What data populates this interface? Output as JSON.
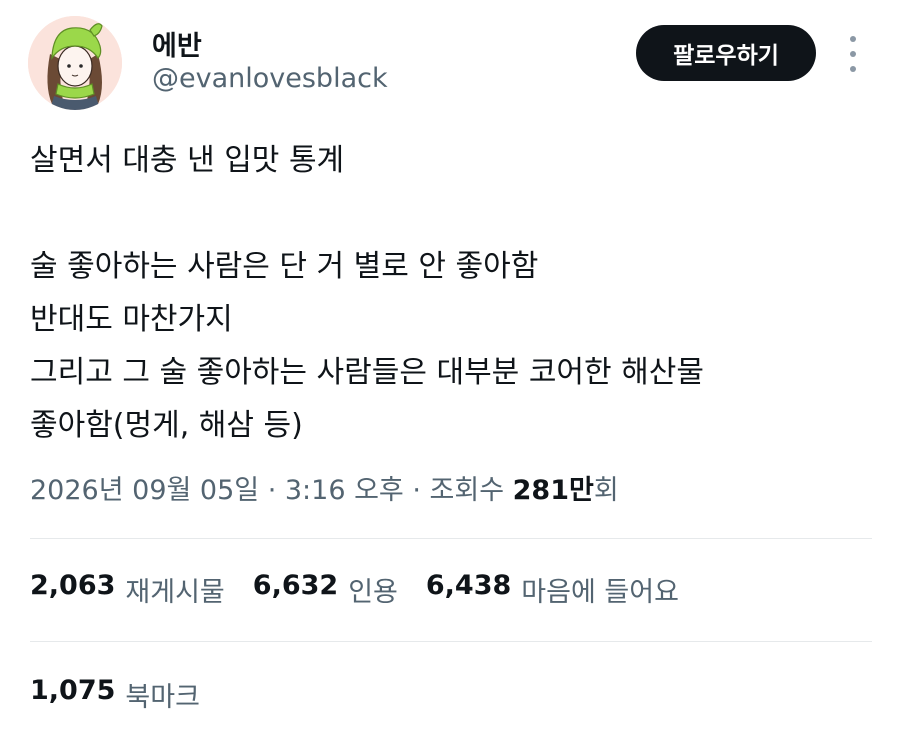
{
  "author": {
    "display_name": "에반",
    "handle": "@evanlovesblack"
  },
  "follow_button_label": "팔로우하기",
  "tweet": {
    "lines": [
      "살면서 대충 낸 입맛 통계",
      "",
      "술 좋아하는 사람은 단 거 별로 안 좋아함",
      "반대도 마찬가지",
      "그리고 그 술 좋아하는 사람들은 대부분 코어한 해산물",
      "좋아함(멍게, 해삼 등)"
    ]
  },
  "meta": {
    "date": "2026년 09월 05일",
    "separator": " · ",
    "time": "3:16 오후",
    "views_label": "조회수 ",
    "views_count": "281만",
    "views_suffix": "회"
  },
  "stats": {
    "reposts": {
      "count": "2,063",
      "label": "재게시물"
    },
    "quotes": {
      "count": "6,632",
      "label": "인용"
    },
    "likes": {
      "count": "6,438",
      "label": "마음에 들어요"
    }
  },
  "bookmarks": {
    "count": "1,075",
    "label": "북마크"
  },
  "colors": {
    "text_primary": "#0f1419",
    "text_secondary": "#536471",
    "button_bg": "#0f1419",
    "avatar_bg": "#fbe3dc",
    "avatar_hat": "#9bd84a"
  },
  "icons": {
    "more": "more-vertical-icon"
  }
}
